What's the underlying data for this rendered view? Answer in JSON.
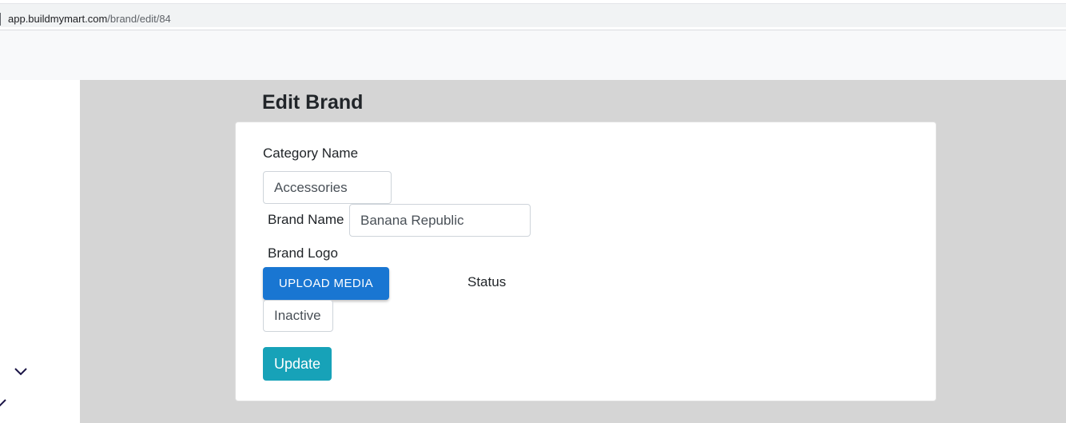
{
  "browser": {
    "url_host": "app.buildmymart.com",
    "url_path": "/brand/edit/84"
  },
  "sidebar": {
    "icons": [
      "chevron-down-icon",
      "chevron-down-icon"
    ]
  },
  "page": {
    "title": "Edit Brand"
  },
  "form": {
    "category_label": "Category Name",
    "category_value": "Accessories",
    "brand_name_label": "Brand Name",
    "brand_name_value": "Banana Republic",
    "brand_logo_label": "Brand Logo",
    "upload_button": "UPLOAD MEDIA",
    "status_label": "Status",
    "status_value": "Inactive",
    "update_button": "Update"
  },
  "colors": {
    "primary": "#1976d2",
    "update": "#17a2b8",
    "content_bg": "#d5d5d5",
    "sidebar_icon": "#1a1446"
  }
}
